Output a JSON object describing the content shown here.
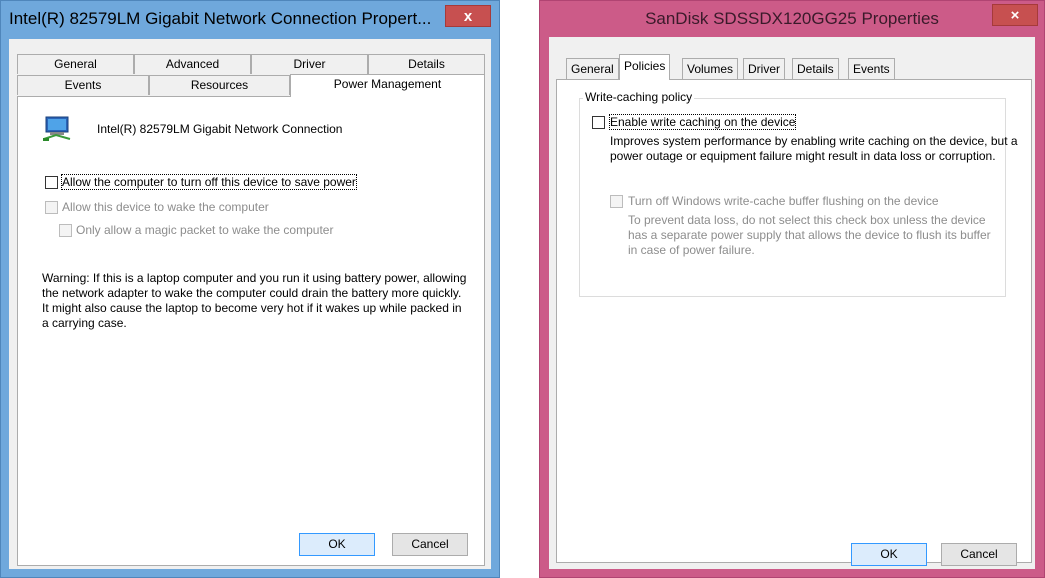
{
  "dialog1": {
    "title": "Intel(R) 82579LM Gigabit Network Connection Propert...",
    "close_label": "x",
    "tabs_row1": [
      "General",
      "Advanced",
      "Driver",
      "Details"
    ],
    "tabs_row2": [
      "Events",
      "Resources",
      "Power Management"
    ],
    "selected_tab": "Power Management",
    "device_name": "Intel(R) 82579LM Gigabit Network Connection",
    "options": {
      "turn_off": "Allow the computer to turn off this device to save power",
      "wake": "Allow this device to wake the computer",
      "magic_packet": "Only allow a magic packet to wake the computer"
    },
    "warning": "Warning: If this is a laptop computer and you run it using battery power, allowing the network adapter to wake the computer could drain the battery more quickly. It might also cause the laptop to become very hot if it wakes up while packed in a carrying case.",
    "ok_label": "OK",
    "cancel_label": "Cancel"
  },
  "dialog2": {
    "title": "SanDisk SDSSDX120GG25 Properties",
    "close_label": "×",
    "tabs": [
      "General",
      "Policies",
      "Volumes",
      "Driver",
      "Details",
      "Events"
    ],
    "selected_tab": "Policies",
    "group_title": "Write-caching policy",
    "enable_write_caching": "Enable write caching on the device",
    "enable_desc": "Improves system performance by enabling write caching on the device, but a power outage or equipment failure might result in data loss or corruption.",
    "turn_off_flushing": "Turn off Windows write-cache buffer flushing on the device",
    "turn_off_desc": "To prevent data loss, do not select this check box unless the device has a separate power supply that allows the device to flush its buffer in case of power failure.",
    "ok_label": "OK",
    "cancel_label": "Cancel"
  },
  "colors": {
    "dialog1_frame": "#6fa8dc",
    "dialog2_frame": "#cc5b88",
    "close_button": "#c75050"
  },
  "icons": {
    "device_icon": "network-adapter-icon"
  }
}
